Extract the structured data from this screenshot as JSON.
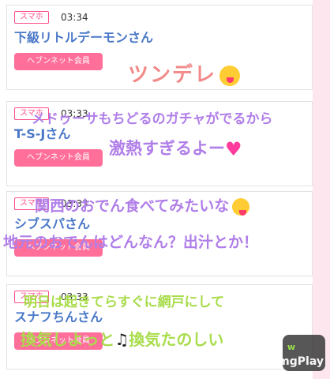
{
  "posts": [
    {
      "badge": "スマホ",
      "time": "03:34",
      "name": "下級リトルデーモンさん",
      "member": "ヘブンネット会員"
    },
    {
      "badge": "スマホ",
      "time": "03:33",
      "name": "T-S-Jさん",
      "member": "ヘブンネット会員"
    },
    {
      "badge": "スマホ",
      "time": "03:33",
      "name": "シブスパさん",
      "member": "ヘブンネット会員"
    },
    {
      "badge": "スマホ",
      "time": "03:33",
      "name": "スナフちんさん",
      "member": "ヘブンネット会員"
    }
  ],
  "overlays": {
    "tsundere": "ツンデレ",
    "gacha_line": "メドゥーサもちどるのガチャがでるから",
    "hype_line": "激熱すぎるよー",
    "oden_line": "関西のおでん食べてみたいな",
    "oden_question": "地元のおでんはどんなん？出汁とか！",
    "morning_line": "明日は起きてらすぐに網戸にして",
    "ventilate_line": "換気しよっと",
    "ventilate_fun": "換気たのしい",
    "w_mark": "w"
  },
  "icons": {
    "tongue_face": "face-with-tongue-icon",
    "heart": "heart-icon",
    "music_note": "music-note-icon"
  },
  "watermark": "imgPlay",
  "colors": {
    "accent": "#ff4f8b",
    "member_button": "#ff6f9a",
    "name": "#4a78c8",
    "overlay_pink": "#f28a8a",
    "overlay_purple": "#b07ee8",
    "overlay_green": "#a8dc4a"
  }
}
